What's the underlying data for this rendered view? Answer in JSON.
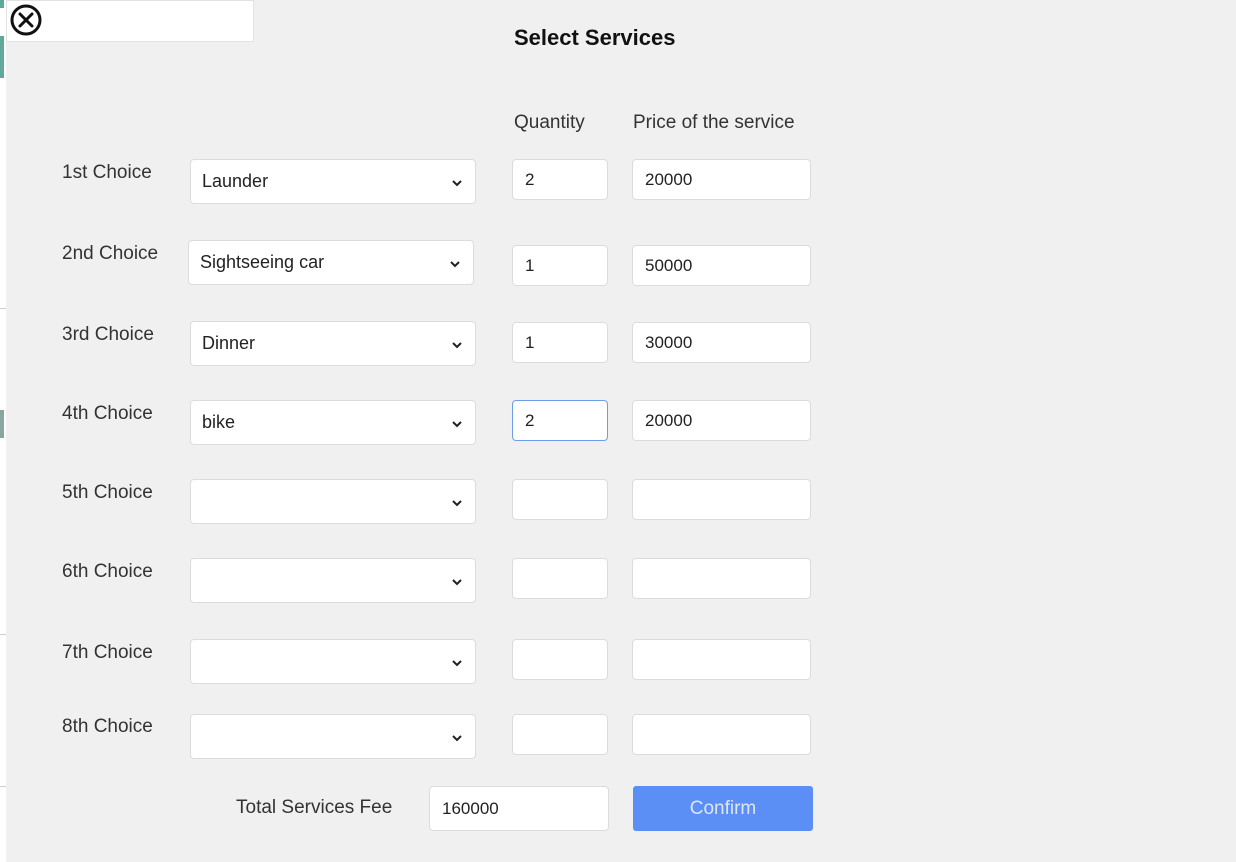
{
  "title": "Select Services",
  "columns": {
    "quantity": "Quantity",
    "price": "Price of the service"
  },
  "rows": [
    {
      "label": "1st Choice",
      "service": "Launder",
      "quantity": "2",
      "price": "20000"
    },
    {
      "label": "2nd Choice",
      "service": "Sightseeing car",
      "quantity": "1",
      "price": "50000"
    },
    {
      "label": "3rd Choice",
      "service": "Dinner",
      "quantity": "1",
      "price": "30000"
    },
    {
      "label": "4th Choice",
      "service": "bike",
      "quantity": "2",
      "price": "20000"
    },
    {
      "label": "5th Choice",
      "service": "",
      "quantity": "",
      "price": ""
    },
    {
      "label": "6th Choice",
      "service": "",
      "quantity": "",
      "price": ""
    },
    {
      "label": "7th Choice",
      "service": "",
      "quantity": "",
      "price": ""
    },
    {
      "label": "8th Choice",
      "service": "",
      "quantity": "",
      "price": ""
    }
  ],
  "total": {
    "label": "Total Services Fee",
    "value": "160000"
  },
  "confirm_label": "Confirm",
  "icons": {
    "close": "close-circle-icon",
    "dropdown": "chevron-down-icon"
  },
  "colors": {
    "accent": "#5b8ff5",
    "panel": "#f0f0f0",
    "focus": "#6e9de8"
  }
}
